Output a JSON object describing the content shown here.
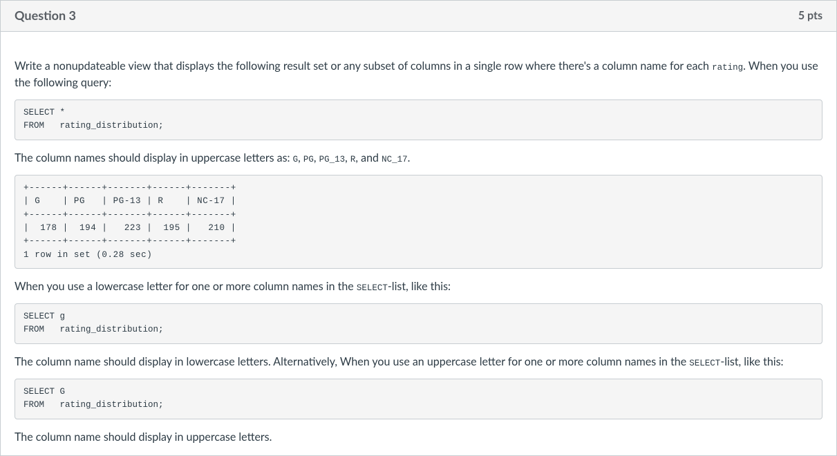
{
  "header": {
    "title": "Question 3",
    "points": "5 pts"
  },
  "body": {
    "para1_a": "Write a nonupdateable view that displays the following result set or any subset of columns in a single row where there's a column name for each ",
    "para1_code": "rating",
    "para1_b": ". When you use the following query:",
    "code1": "SELECT *\nFROM   rating_distribution;",
    "para2_a": "The column names should display in uppercase letters as: ",
    "para2_code1": "G",
    "para2_sep1": ", ",
    "para2_code2": "PG",
    "para2_sep2": ", ",
    "para2_code3": "PG_13",
    "para2_sep3": ", ",
    "para2_code4": "R",
    "para2_sep4": ", and ",
    "para2_code5": "NC_17",
    "para2_b": ".",
    "code2": "+------+------+-------+------+-------+\n| G    | PG   | PG-13 | R    | NC-17 |\n+------+------+-------+------+-------+\n|  178 |  194 |   223 |  195 |   210 |\n+------+------+-------+------+-------+\n1 row in set (0.28 sec)",
    "para3_a": "When you use a lowercase letter for one or more column names in the ",
    "para3_code": "SELECT",
    "para3_b": "-list, like this:",
    "code3": "SELECT g\nFROM   rating_distribution;",
    "para4_a": "The column name should display in lowercase letters. Alternatively, When you use an uppercase letter for one or more column names in the ",
    "para4_code": "SELECT",
    "para4_b": "-list, like this:",
    "code4": "SELECT G\nFROM   rating_distribution;",
    "para5": "The column name should display in uppercase letters."
  }
}
